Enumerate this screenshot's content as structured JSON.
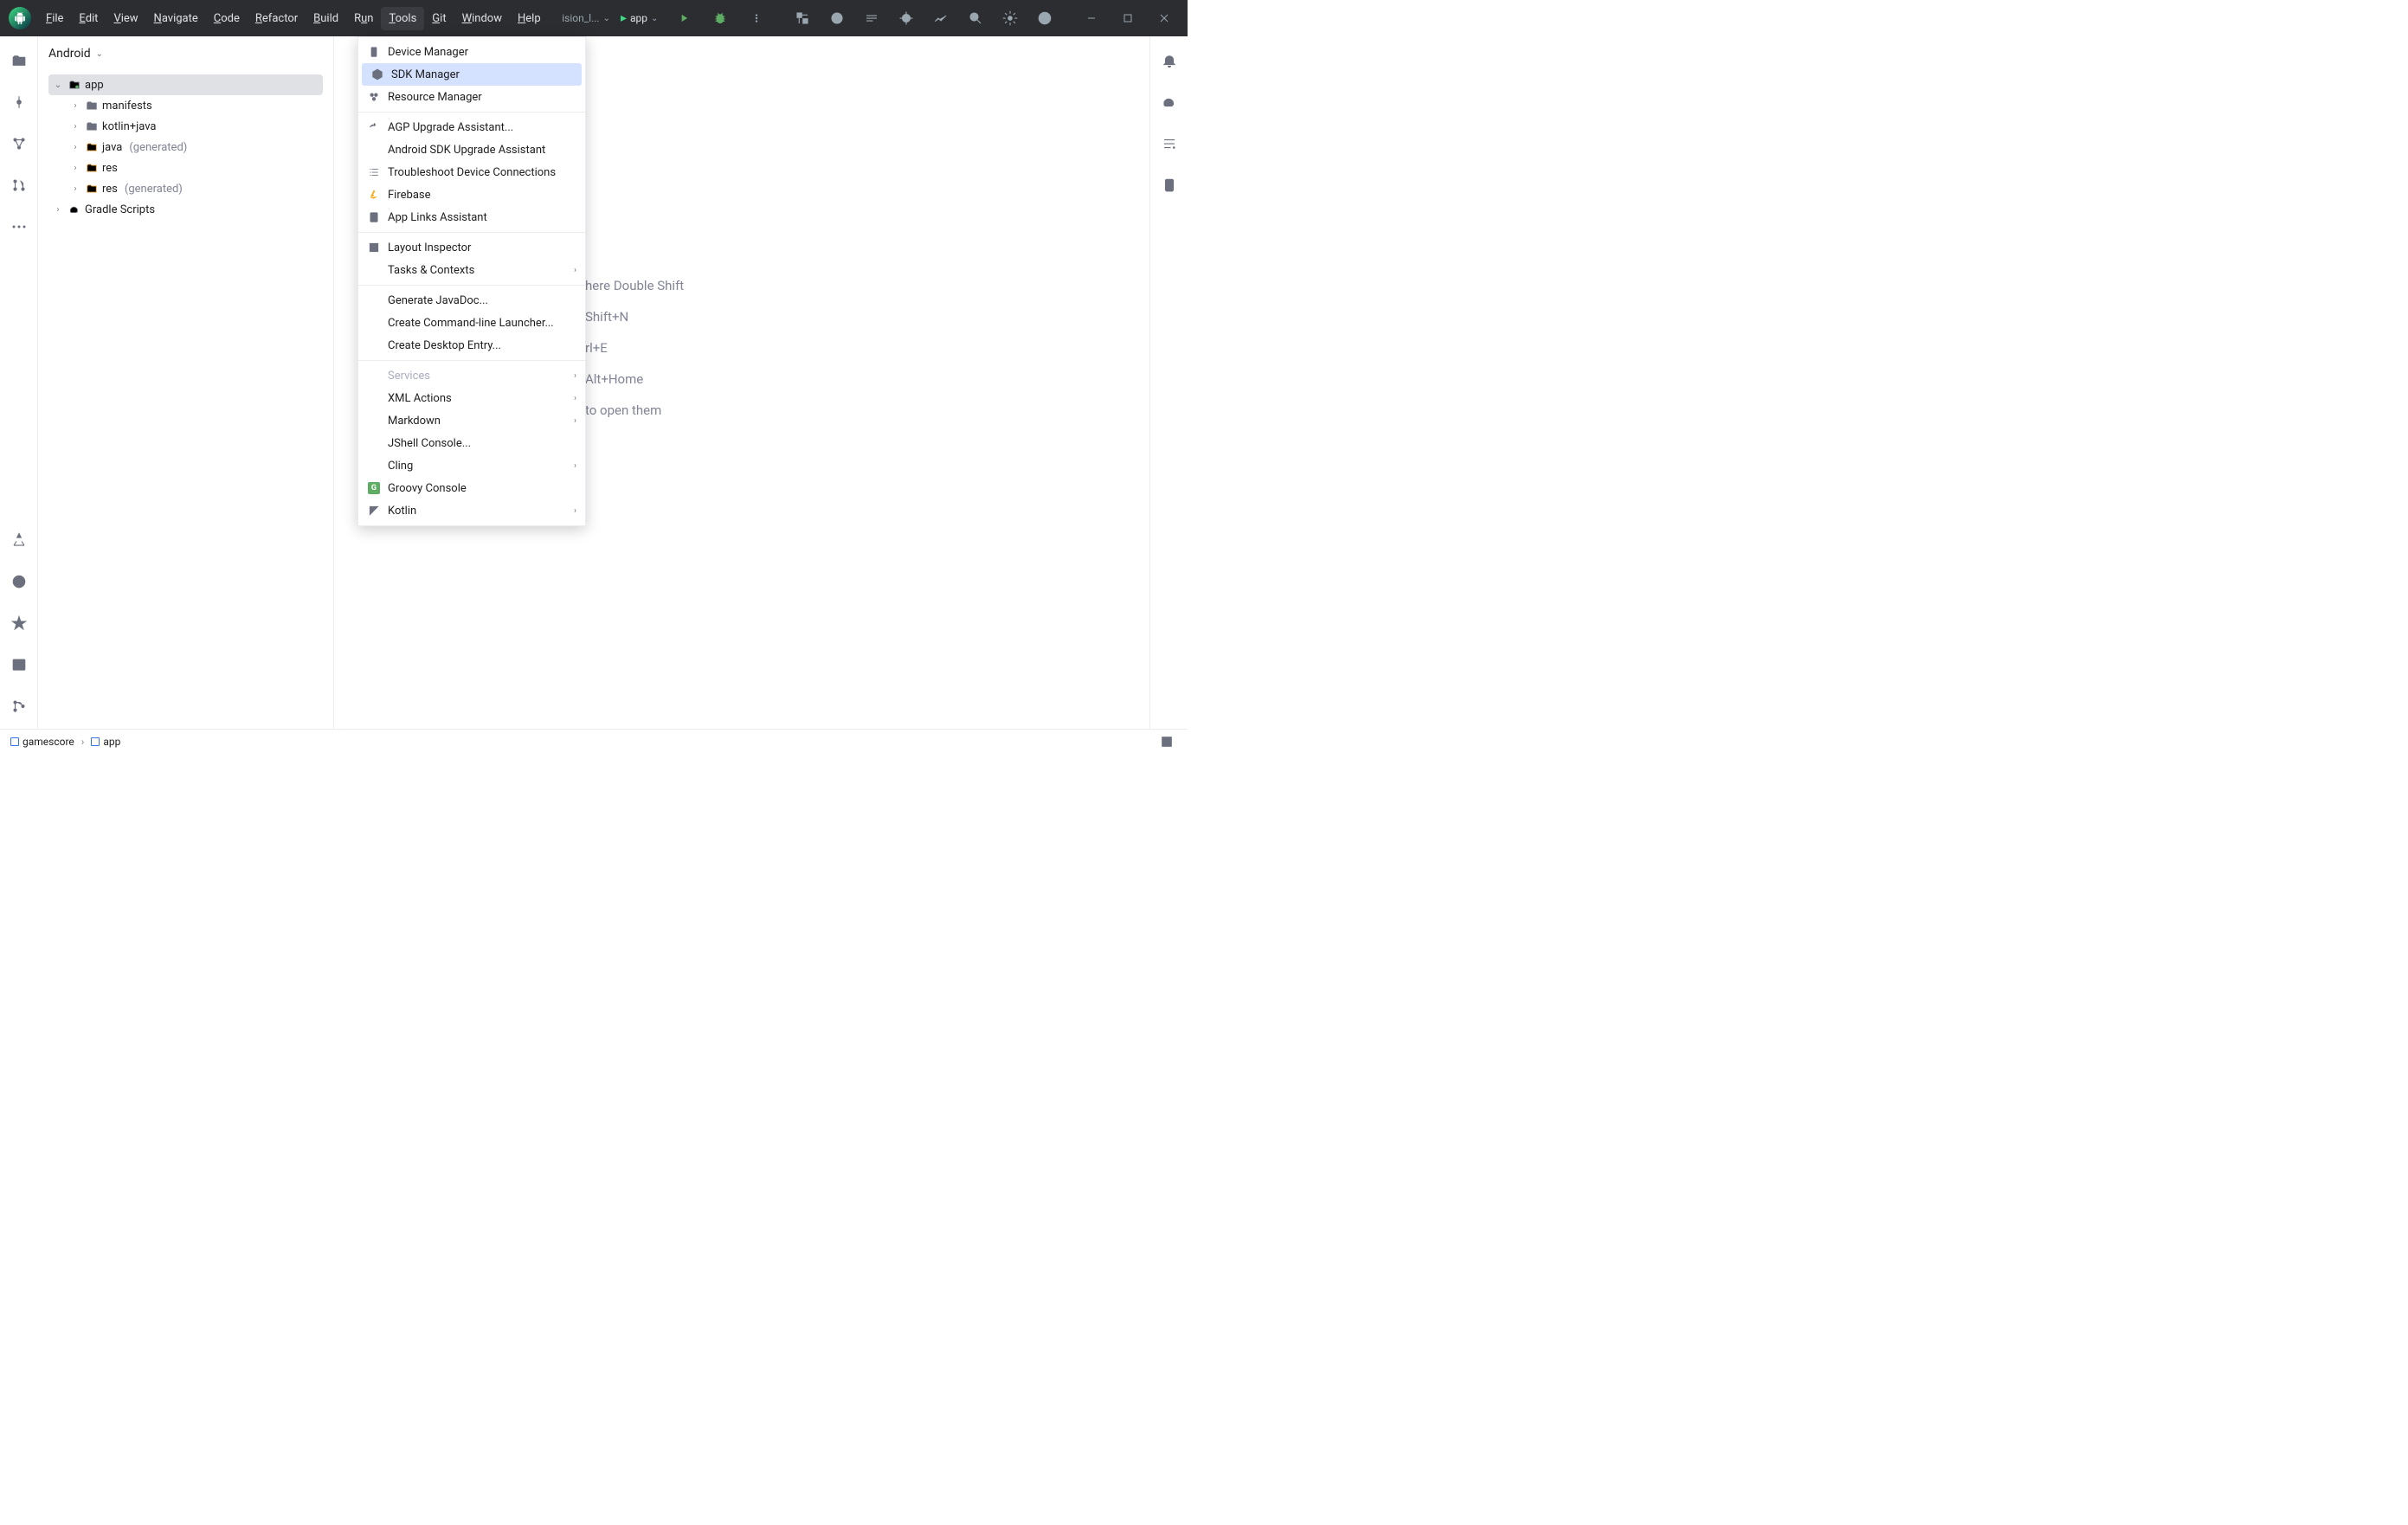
{
  "menubar": {
    "file": "File",
    "edit": "Edit",
    "view": "View",
    "navigate": "Navigate",
    "code": "Code",
    "refactor": "Refactor",
    "build": "Build",
    "run": "Run",
    "tools": "Tools",
    "git": "Git",
    "window": "Window",
    "help": "Help"
  },
  "titlebar": {
    "run_config_truncated": "ision_l...",
    "app_label": "app"
  },
  "project": {
    "header": "Android",
    "tree": {
      "app": "app",
      "manifests": "manifests",
      "kotlin_java": "kotlin+java",
      "java": "java",
      "java_gen": "(generated)",
      "res": "res",
      "res_gen": "(generated)",
      "gradle_scripts": "Gradle Scripts"
    }
  },
  "tools_menu": {
    "device_manager": "Device Manager",
    "sdk_manager": "SDK Manager",
    "resource_manager": "Resource Manager",
    "agp_upgrade": "AGP Upgrade Assistant...",
    "android_sdk_upgrade": "Android SDK Upgrade Assistant",
    "troubleshoot_device": "Troubleshoot Device Connections",
    "firebase": "Firebase",
    "app_links": "App Links Assistant",
    "layout_inspector": "Layout Inspector",
    "tasks_contexts": "Tasks & Contexts",
    "generate_javadoc": "Generate JavaDoc...",
    "create_cmdline": "Create Command-line Launcher...",
    "create_desktop": "Create Desktop Entry...",
    "services": "Services",
    "xml_actions": "XML Actions",
    "markdown": "Markdown",
    "jshell": "JShell Console...",
    "cling": "Cling",
    "groovy_console": "Groovy Console",
    "kotlin": "Kotlin"
  },
  "welcome": {
    "hint1": "here Double Shift",
    "hint2": "Shift+N",
    "hint3": "rl+E",
    "hint4": "Alt+Home",
    "hint5": "to open them"
  },
  "statusbar": {
    "breadcrumb1": "gamescore",
    "breadcrumb2": "app"
  }
}
